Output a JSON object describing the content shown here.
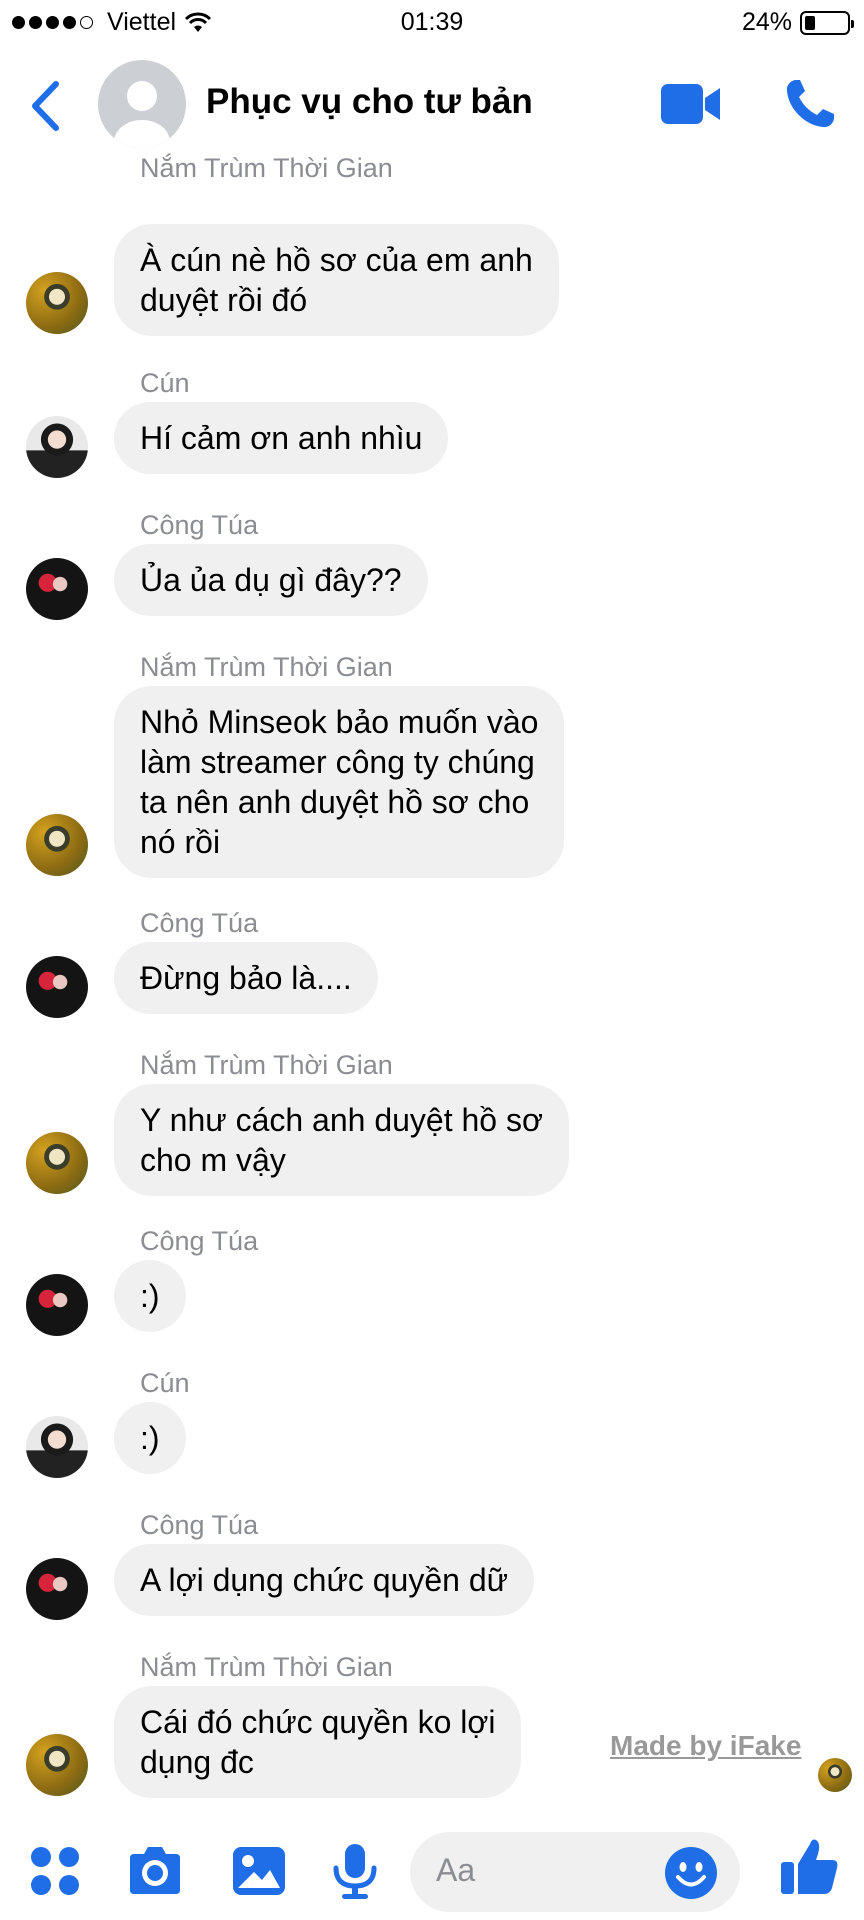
{
  "status": {
    "carrier": "Viettel",
    "time": "01:39",
    "battery": "24%"
  },
  "header": {
    "title": "Phục vụ cho tư bản"
  },
  "messages": [
    {
      "sender": "Nắm Trùm Thời Gian",
      "lines": [
        "À cún nè hồ sơ của em anh",
        "duyệt rồi đó"
      ]
    },
    {
      "sender": "Cún",
      "lines": [
        "Hí cảm ơn anh nhìu"
      ]
    },
    {
      "sender": "Công Túa",
      "lines": [
        "Ủa ủa dụ gì đây??"
      ]
    },
    {
      "sender": "Nắm Trùm Thời Gian",
      "lines": [
        "Nhỏ Minseok bảo muốn vào",
        "làm streamer công ty chúng",
        "ta nên anh duyệt hồ sơ cho",
        "nó rồi"
      ]
    },
    {
      "sender": "Công Túa",
      "lines": [
        "Đừng bảo là...."
      ]
    },
    {
      "sender": "Nắm Trùm Thời Gian",
      "lines": [
        "Y như cách anh duyệt hồ sơ",
        "cho m vậy"
      ]
    },
    {
      "sender": "Công Túa",
      "lines": [
        ":)"
      ]
    },
    {
      "sender": "Cún",
      "lines": [
        ":)"
      ]
    },
    {
      "sender": "Công Túa",
      "lines": [
        "A lợi dụng chức quyền dữ"
      ]
    },
    {
      "sender": "Nắm Trùm Thời Gian",
      "lines": [
        "Cái đó chức quyền ko lợi",
        "dụng đc"
      ]
    }
  ],
  "watermark": "Made by iFake",
  "composer": {
    "placeholder": "Aa"
  },
  "icons": {
    "back": "chevron-left-icon",
    "video": "video-camera-icon",
    "call": "phone-icon",
    "more": "four-dots-icon",
    "camera": "camera-icon",
    "gallery": "image-icon",
    "mic": "microphone-icon",
    "emoji": "smiley-icon",
    "like": "thumbs-up-icon"
  },
  "colors": {
    "accent": "#1f6ee8",
    "bubble": "#f0f0f0",
    "sender_text": "#8a8d91"
  }
}
